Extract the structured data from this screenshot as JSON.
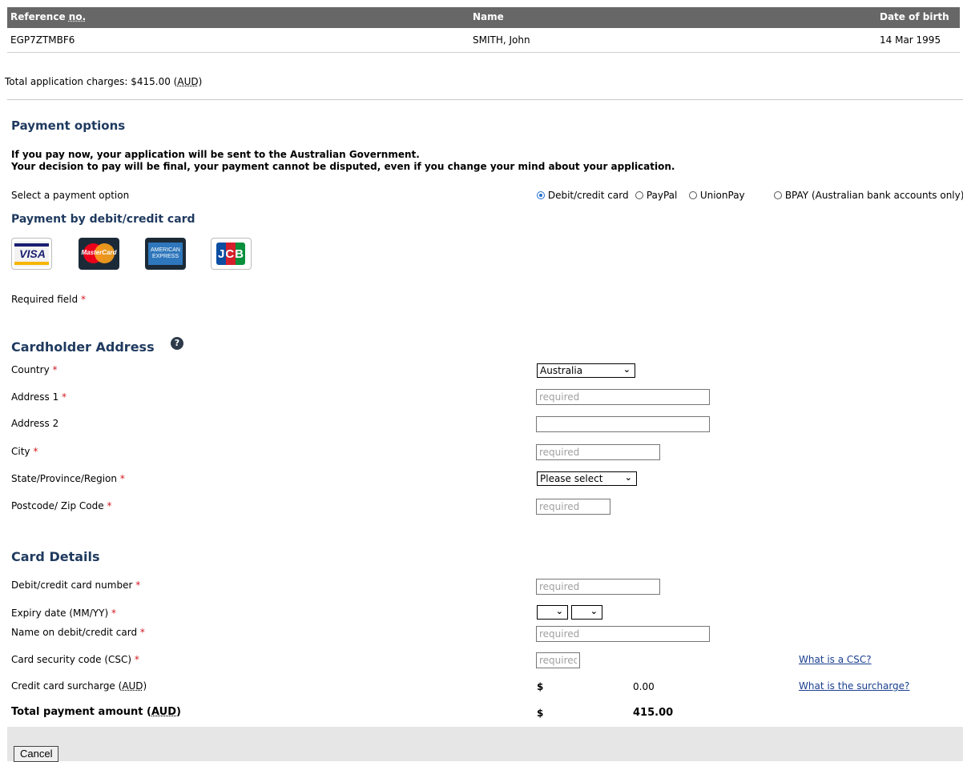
{
  "applicant_table": {
    "headers": {
      "ref_prefix": "Reference ",
      "ref_abbr": "no.",
      "name": "Name",
      "dob": "Date of birth"
    },
    "row": {
      "ref": "EGP7ZTMBF6",
      "name": "SMITH, John",
      "dob": "14 Mar 1995"
    }
  },
  "charges": {
    "prefix": "Total application charges: $415.00 (",
    "currency": "AUD",
    "suffix": ")"
  },
  "payment_options": {
    "title": "Payment options",
    "warning_line1": "If you pay now, your application will be sent to the Australian Government.",
    "warning_line2": "Your decision to pay will be final, your payment cannot be disputed, even if you change your mind about your application.",
    "select_label": "Select a payment option",
    "options": [
      "Debit/credit card",
      "PayPal",
      "UnionPay",
      "BPAY (Australian bank accounts only)"
    ],
    "selected": "Debit/credit card"
  },
  "card_payment": {
    "title": "Payment by debit/credit card",
    "logos": [
      {
        "name": "VISA",
        "text": "VISA",
        "color": "#1a1f71"
      },
      {
        "name": "MasterCard",
        "text": "MasterCard",
        "color": "#eb001b"
      },
      {
        "name": "American Express",
        "line1": "AMERICAN",
        "line2": "EXPRESS",
        "color": "#2e77bc"
      },
      {
        "name": "JCB",
        "text": "JCB",
        "color": "#0b4ea2"
      }
    ]
  },
  "required_note": {
    "label": "Required field ",
    "star": "*"
  },
  "address": {
    "title": "Cardholder Address",
    "help_icon": "question-circle-icon",
    "country_label": "Country ",
    "country_value": "Australia",
    "address1_label": "Address 1 ",
    "address1_placeholder": "required",
    "address2_label": "Address 2",
    "city_label": "City ",
    "city_placeholder": "required",
    "state_label": "State/Province/Region ",
    "state_value": "Please select",
    "postcode_label": "Postcode/ Zip Code ",
    "postcode_placeholder": "required",
    "star": "*"
  },
  "card_details": {
    "title": "Card Details",
    "number_label": "Debit/credit card number ",
    "number_placeholder": "required",
    "expiry_label": "Expiry date (MM/YY) ",
    "name_label": "Name on debit/credit card ",
    "name_placeholder": "required",
    "csc_label": "Card security code (CSC) ",
    "csc_placeholder": "required",
    "csc_link": "What is a CSC?",
    "surcharge_label_prefix": "Credit card surcharge (",
    "surcharge_label_abbr": "AUD",
    "surcharge_label_suffix": ")",
    "surcharge_currency": "$",
    "surcharge_value": "0.00",
    "surcharge_link": "What is the surcharge?",
    "total_label_prefix": "Total payment amount (",
    "total_label_abbr": "AUD",
    "total_label_suffix": ")",
    "total_currency": "$",
    "total_value": "415.00",
    "star": "*"
  },
  "footer": {
    "cancel_label": "Cancel"
  },
  "colors": {
    "heading": "#1f3a5f",
    "required_star": "#d3181f",
    "table_header": "#676767",
    "link": "#1a3f8f"
  }
}
